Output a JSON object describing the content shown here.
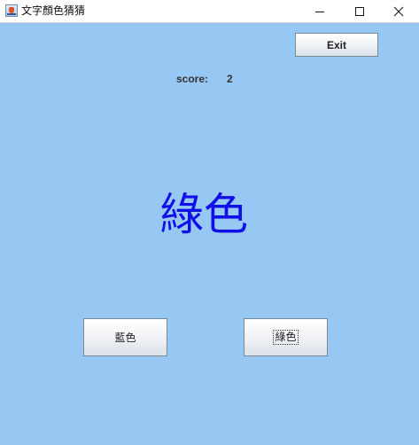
{
  "window": {
    "title": "文字顏色猜猜",
    "app_icon": "java-cup-icon",
    "controls": {
      "minimize_icon": "minimize-icon",
      "maximize_icon": "maximize-icon",
      "close_icon": "close-icon"
    }
  },
  "toolbar": {
    "exit_label": "Exit"
  },
  "score": {
    "label": "score:",
    "value": "2"
  },
  "prompt": {
    "word": "綠色",
    "word_color": "#1010e6"
  },
  "choices": [
    {
      "label": "藍色",
      "focused": false
    },
    {
      "label": "綠色",
      "focused": true
    }
  ],
  "colors": {
    "background": "#97c7f3"
  }
}
